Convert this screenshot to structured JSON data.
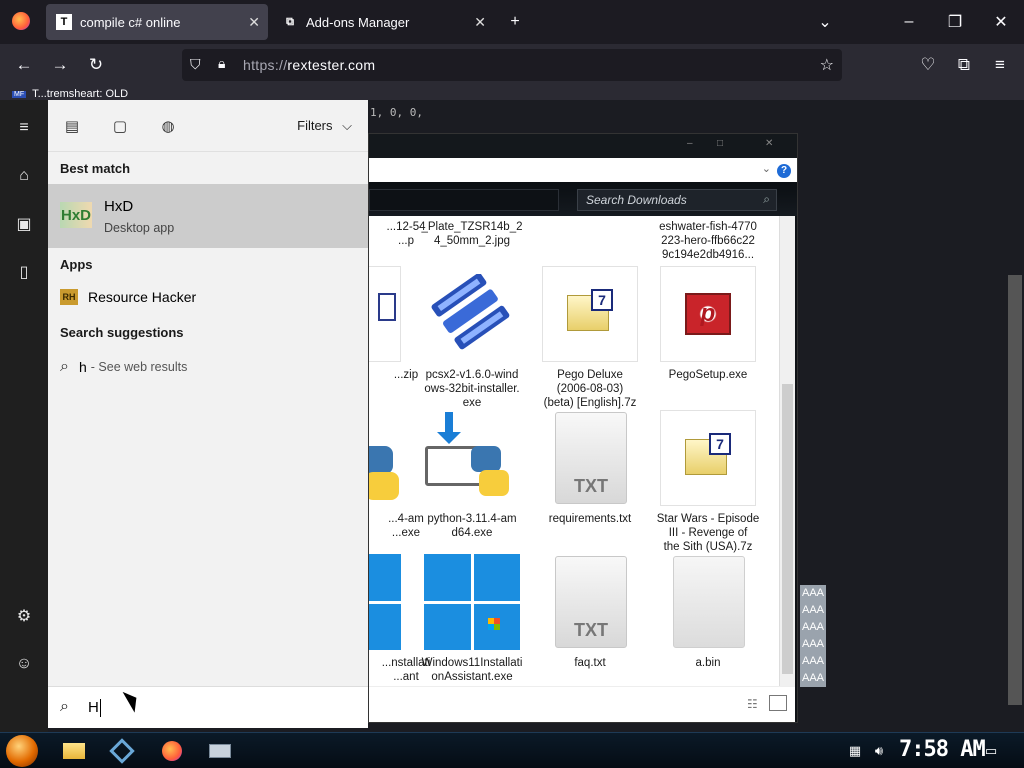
{
  "browser": {
    "tabs": [
      {
        "label": "compile c# online",
        "favicon": "T",
        "active": true
      },
      {
        "label": "Add-ons Manager",
        "favicon": "puzzle-icon",
        "active": false
      }
    ],
    "url_protocol": "https://",
    "url_host": "rextester.com",
    "bookmark": {
      "badge": "MF",
      "label": "T...tremsheart: OLD"
    },
    "code_line": "1, 0, 0,"
  },
  "explorer": {
    "search_placeholder": "Search Downloads",
    "help": "?",
    "files": [
      {
        "name": "...12-54\n...p",
        "kind": "partial"
      },
      {
        "name": "_Plate_TZSR14b_2\n4_50mm_2.jpg",
        "kind": "label"
      },
      {
        "name": "eshwater-fish-4770\n223-hero-ffb66c22\n9c194e2db4916...",
        "kind": "label"
      },
      {
        "name": "...zip",
        "kind": "7z-partial"
      },
      {
        "name": "pcsx2-v1.6.0-wind\nows-32bit-installer.\nexe",
        "kind": "pcsx2"
      },
      {
        "name": "Pego Deluxe\n(2006-08-03)\n(beta) [English].7z",
        "kind": "7z"
      },
      {
        "name": "PegoSetup.exe",
        "kind": "pego"
      },
      {
        "name": "...4-am\n...exe",
        "kind": "python-partial"
      },
      {
        "name": "python-3.11.4-am\nd64.exe",
        "kind": "python"
      },
      {
        "name": "requirements.txt",
        "kind": "txt"
      },
      {
        "name": "Star Wars - Episode\nIII - Revenge of\nthe Sith (USA).7z",
        "kind": "7z"
      },
      {
        "name": "...nstallati\n...ant\n...e",
        "kind": "win-partial"
      },
      {
        "name": "Windows11Installati\nonAssistant.exe",
        "kind": "win"
      },
      {
        "name": "faq.txt",
        "kind": "txt"
      },
      {
        "name": "a.bin",
        "kind": "bin"
      }
    ]
  },
  "start": {
    "filters_label": "Filters",
    "best_match_header": "Best match",
    "best_match": {
      "name": "HxD",
      "sub": "Desktop app"
    },
    "apps_header": "Apps",
    "apps": [
      {
        "name": "Resource Hacker"
      }
    ],
    "suggestions_header": "Search suggestions",
    "suggestion": {
      "term": "h",
      "note": "- See web results"
    },
    "search_value": "H"
  },
  "aaa_lines": [
    "AAA",
    "AAA",
    "AAA",
    "AAA",
    "AAA",
    "AAA"
  ],
  "taskbar": {
    "clock": "7:58 AM"
  },
  "colors": {
    "browser_tabbar": "#1c1b22",
    "browser_nav": "#2b2a33",
    "start_panel": "#f2f2f2",
    "best_match_bg": "#cccccc",
    "taskbar": "#0b1a28"
  }
}
